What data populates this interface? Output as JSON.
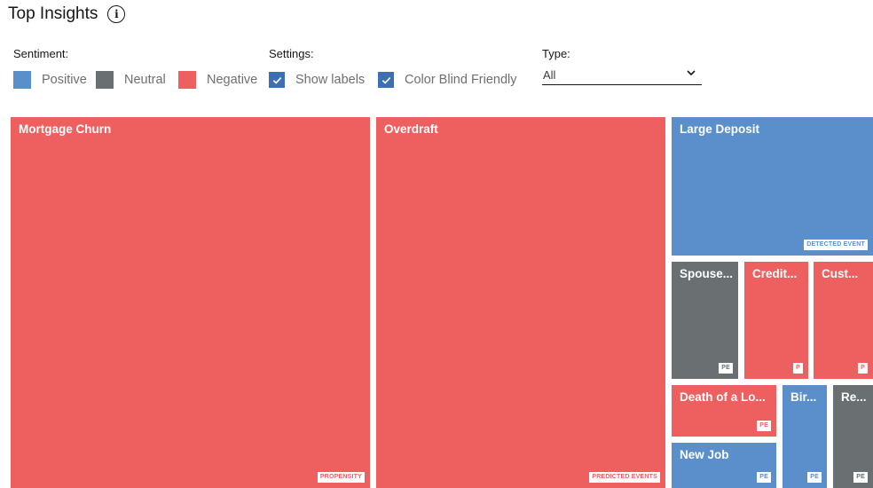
{
  "header": {
    "title": "Top Insights",
    "info_icon": "info-icon"
  },
  "controls": {
    "sentiment_label": "Sentiment:",
    "settings_label": "Settings:",
    "type_label": "Type:",
    "legend": [
      {
        "label": "Positive",
        "color": "#5b8fcc"
      },
      {
        "label": "Neutral",
        "color": "#6a7071"
      },
      {
        "label": "Negative",
        "color": "#ee5f5f"
      }
    ],
    "settings": [
      {
        "label": "Show labels",
        "checked": true
      },
      {
        "label": "Color Blind Friendly",
        "checked": true
      }
    ],
    "type_select": {
      "value": "All",
      "icon": "chevron-down-icon"
    }
  },
  "chart_data": {
    "type": "treemap",
    "colors": {
      "Positive": "#5b8fcc",
      "Neutral": "#6a7071",
      "Negative": "#ee5f5f"
    },
    "items": [
      {
        "label": "Mortgage Churn",
        "sentiment": "Negative",
        "tag": "PROPENSITY"
      },
      {
        "label": "Overdraft",
        "sentiment": "Negative",
        "tag": "PREDICTED EVENTS"
      },
      {
        "label": "Large Deposit",
        "sentiment": "Positive",
        "tag": "DETECTED EVENT"
      },
      {
        "label": "Spouse...",
        "sentiment": "Neutral",
        "tag": "PE"
      },
      {
        "label": "Credit...",
        "sentiment": "Negative",
        "tag": "P"
      },
      {
        "label": "Cust...",
        "sentiment": "Negative",
        "tag": "P"
      },
      {
        "label": "Death of a Lo...",
        "sentiment": "Negative",
        "tag": "PE"
      },
      {
        "label": "Bir...",
        "sentiment": "Positive",
        "tag": "PE"
      },
      {
        "label": "Re...",
        "sentiment": "Neutral",
        "tag": "PE"
      },
      {
        "label": "New Job",
        "sentiment": "Positive",
        "tag": "PE"
      }
    ]
  }
}
